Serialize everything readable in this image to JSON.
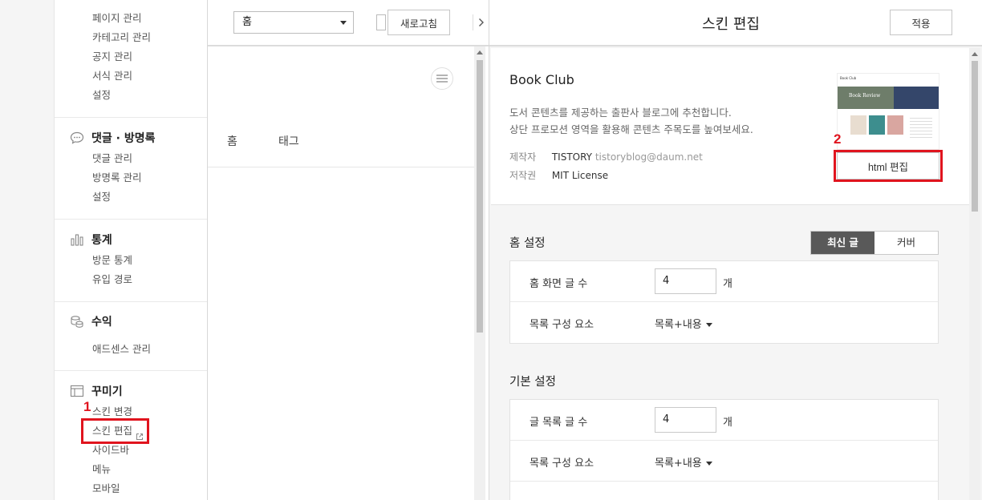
{
  "sidebar": {
    "top_items": [
      "페이지 관리",
      "카테고리 관리",
      "공지 관리",
      "서식 관리",
      "설정"
    ],
    "comments": {
      "title": "댓글 · 방명록",
      "items": [
        "댓글 관리",
        "방명록 관리",
        "설정"
      ]
    },
    "stats": {
      "title": "통계",
      "items": [
        "방문 통계",
        "유입 경로"
      ]
    },
    "revenue": {
      "title": "수익",
      "items": [
        "애드센스 관리"
      ]
    },
    "decorate": {
      "title": "꾸미기",
      "items": [
        "스킨 변경",
        "스킨 편집",
        "사이드바",
        "메뉴",
        "모바일"
      ]
    }
  },
  "annotations": {
    "step1": "1",
    "step2": "2"
  },
  "preview": {
    "page_select": "홈",
    "refresh_label": "새로고침",
    "nav": [
      "홈",
      "태그"
    ]
  },
  "editor": {
    "title": "스킨 편집",
    "apply_label": "적용",
    "skin": {
      "name": "Book Club",
      "desc1": "도서 콘텐츠를 제공하는 출판사 블로그에 추천합니다.",
      "desc2": "상단 프로모션 영역을 활용해 콘텐츠 주목도를 높여보세요.",
      "maker_label": "제작자",
      "maker": "TISTORY",
      "maker_email": "tistoryblog@daum.net",
      "license_label": "저작권",
      "license": "MIT License",
      "thumb_title": "Book Review",
      "thumb_logo": "Book Club",
      "html_edit_label": "html 편집"
    },
    "home": {
      "title": "홈 설정",
      "tab_latest": "최신 글",
      "tab_cover": "커버",
      "post_count_label": "홈 화면 글 수",
      "post_count": "4",
      "unit": "개",
      "list_elements_label": "목록 구성 요소",
      "list_elements_value": "목록+내용"
    },
    "basic": {
      "title": "기본 설정",
      "post_count_label": "글 목록 글 수",
      "post_count": "4",
      "unit": "개",
      "list_elements_label": "목록 구성 요소",
      "list_elements_value": "목록+내용"
    }
  },
  "colors": {
    "annotation_red": "#e0141e",
    "tab_active": "#595959"
  }
}
